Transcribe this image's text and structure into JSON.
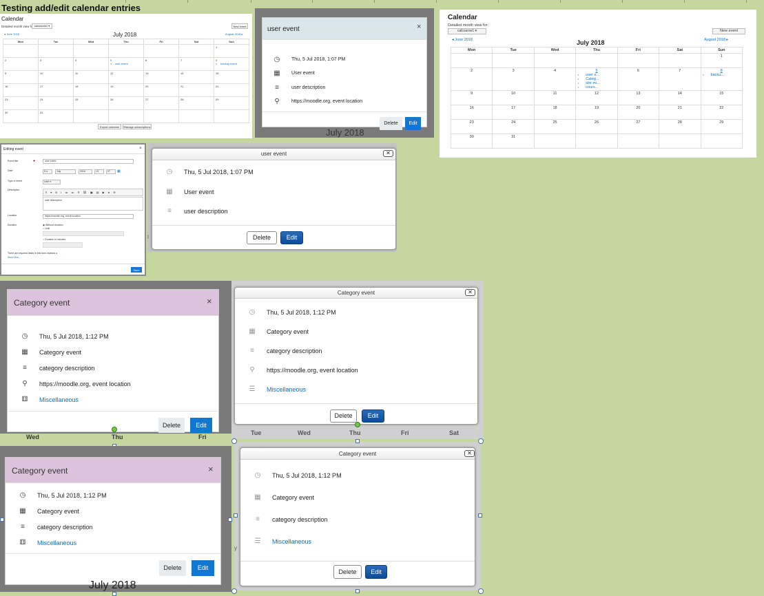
{
  "page_title": "Testing add/edit calendar entries",
  "colors": {
    "background": "#c5d79f",
    "primary": "#1177d1",
    "category_header": "#dcc3dc",
    "user_header": "#d9e6ea",
    "link": "#0f6fc5"
  },
  "cal_small": {
    "title": "Calendar",
    "view_label": "Detailed month view for:",
    "course_select": "calcourse1",
    "new_event": "New event",
    "prev": "June 2018",
    "month": "July 2018",
    "next": "August 2018",
    "days": [
      "Mon",
      "Tue",
      "Wed",
      "Thu",
      "Fri",
      "Sat",
      "Sun"
    ],
    "weeks": [
      [
        "",
        "",
        "",
        "",
        "",
        "",
        "1"
      ],
      [
        "2",
        "3",
        "4",
        "5",
        "6",
        "7",
        "8"
      ],
      [
        "9",
        "10",
        "11",
        "12",
        "13",
        "14",
        "15"
      ],
      [
        "16",
        "17",
        "18",
        "19",
        "20",
        "21",
        "22"
      ],
      [
        "23",
        "24",
        "25",
        "26",
        "27",
        "28",
        "29"
      ],
      [
        "30",
        "31",
        "",
        "",
        "",
        "",
        ""
      ]
    ],
    "event_thu5": "user event",
    "event_sun8": "backup event",
    "export": "Export calendar",
    "manage": "Manage subscriptions"
  },
  "modal_user_bs": {
    "title": "user event",
    "close": "×",
    "datetime": "Thu, 5 Jul 2018, 1:07 PM",
    "type": "User event",
    "description": "user description",
    "location": "https://moodle.org, event location",
    "delete": "Delete",
    "edit": "Edit",
    "icons": [
      "clock-icon",
      "calendar-icon",
      "align-left-icon",
      "map-marker-icon"
    ]
  },
  "behind_month_1": "July 2018",
  "cal_right": {
    "title": "Calendar",
    "view_label": "Detailed month view for:",
    "course_select": "calcourse1",
    "new_event": "New event",
    "prev": "June 2018",
    "month": "July 2018",
    "next": "August 2018",
    "days": [
      "Mon",
      "Tue",
      "Wed",
      "Thu",
      "Fri",
      "Sat",
      "Sun"
    ],
    "weeks": [
      [
        "",
        "",
        "",
        "",
        "",
        "",
        "1"
      ],
      [
        "2",
        "3",
        "4",
        "5",
        "6",
        "7",
        "8"
      ],
      [
        "9",
        "10",
        "11",
        "12",
        "13",
        "14",
        "15"
      ],
      [
        "16",
        "17",
        "18",
        "19",
        "20",
        "21",
        "22"
      ],
      [
        "23",
        "24",
        "25",
        "26",
        "27",
        "28",
        "29"
      ],
      [
        "30",
        "31",
        "",
        "",
        "",
        "",
        ""
      ]
    ],
    "thu5_events": [
      "user e...",
      "Categ...",
      "site ev...",
      "cours..."
    ],
    "sun8_events": [
      "backu..."
    ]
  },
  "edit_form": {
    "title": "Editing event",
    "close": "×",
    "event_title_label": "Event title",
    "event_title_value": "user event",
    "date_label": "Date",
    "date_day": "5",
    "date_month": "July",
    "date_year": "2018",
    "date_hour": "13",
    "date_min": "07",
    "type_label": "Type of event",
    "type_value": "User",
    "desc_label": "Description",
    "desc_value": "user description",
    "location_label": "Location",
    "location_value": "https://moodle.org, event location",
    "duration_label": "Duration",
    "dur_opt1": "Without duration",
    "dur_opt2": "Until",
    "dur_opt3": "Duration in minutes",
    "required_note": "There are required fields in this form marked",
    "show_less": "Show less...",
    "save": "Save"
  },
  "modal_user_x": {
    "title": "user event",
    "datetime": "Thu, 5 Jul 2018, 1:07 PM",
    "type": "User event",
    "description": "user description",
    "delete": "Delete",
    "edit": "Edit"
  },
  "modal_cat_bs1": {
    "title": "Category event",
    "close": "×",
    "datetime": "Thu, 5 Jul 2018, 1:12 PM",
    "type": "Category event",
    "description": "category description",
    "location": "https://moodle.org, event location",
    "category": "Miscellaneous",
    "delete": "Delete",
    "edit": "Edit"
  },
  "behind_days_1": [
    "Wed",
    "Thu",
    "Fri"
  ],
  "modal_cat_x1": {
    "title": "Category event",
    "datetime": "Thu, 5 Jul 2018, 1:12 PM",
    "type": "Category event",
    "description": "category description",
    "location": "https://moodle.org, event location",
    "category": "Miscellaneous",
    "delete": "Delete",
    "edit": "Edit"
  },
  "behind_days_2": [
    "Tue",
    "Wed",
    "Thu",
    "Fri",
    "Sat"
  ],
  "modal_cat_bs2": {
    "title": "Category event",
    "close": "×",
    "datetime": "Thu, 5 Jul 2018, 1:12 PM",
    "type": "Category event",
    "description": "category description",
    "category": "Miscellaneous",
    "delete": "Delete",
    "edit": "Edit"
  },
  "behind_month_2": "July 2018",
  "modal_cat_x2": {
    "title": "Category event",
    "datetime": "Thu, 5 Jul 2018, 1:12 PM",
    "type": "Category event",
    "description": "category description",
    "category": "Miscellaneous",
    "delete": "Delete",
    "edit": "Edit"
  }
}
